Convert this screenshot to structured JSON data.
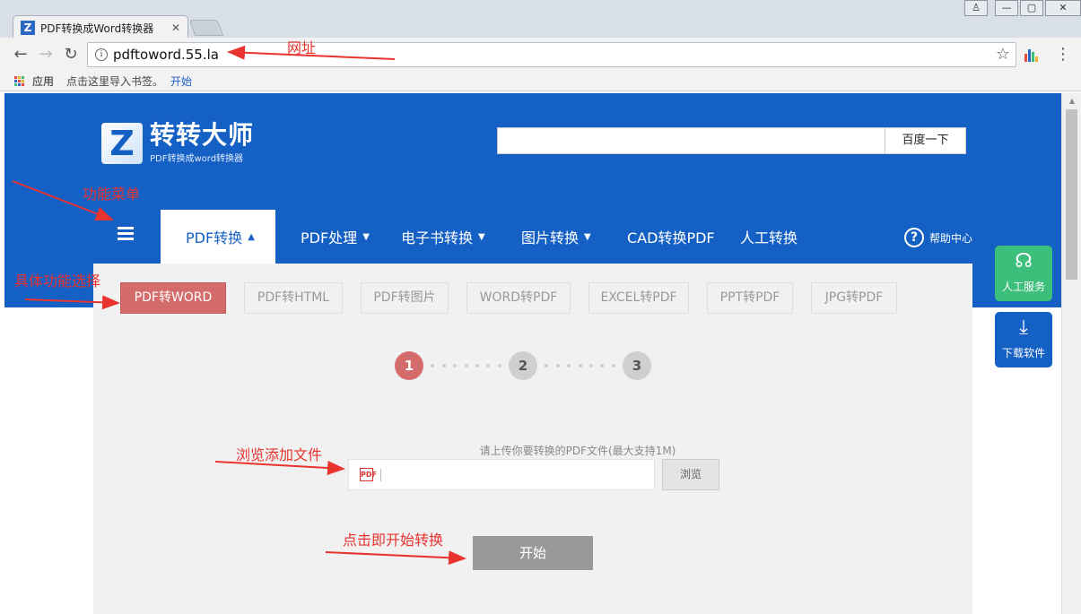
{
  "browser": {
    "tab_title": "PDF转换成Word转换器",
    "tab_close": "✕",
    "favicon_letter": "Z",
    "window_user": "♙",
    "window_minimize": "—",
    "window_maximize": "▢",
    "window_close": "✕",
    "back": "←",
    "forward": "→",
    "reload": "↻",
    "url": "pdftoword.55.la",
    "info": "i",
    "star": "☆",
    "menu": "⋮",
    "bookmarks": {
      "apps": "应用",
      "hint": "点击这里导入书签。",
      "start": "开始"
    }
  },
  "site": {
    "logo_letter": "Z",
    "logo_main": "转转大师",
    "logo_sub": "PDF转换成word转换器",
    "search_button": "百度一下",
    "search_value": "",
    "nav": [
      {
        "label": "PDF转换",
        "caret": "▲"
      },
      {
        "label": "PDF处理",
        "caret": "▼"
      },
      {
        "label": "电子书转换",
        "caret": "▼"
      },
      {
        "label": "图片转换",
        "caret": "▼"
      },
      {
        "label": "CAD转换PDF",
        "caret": ""
      },
      {
        "label": "人工转换",
        "caret": ""
      }
    ],
    "help": {
      "icon": "?",
      "label": "帮助中心"
    },
    "subtabs": [
      "PDF转WORD",
      "PDF转HTML",
      "PDF转图片",
      "WORD转PDF",
      "EXCEL转PDF",
      "PPT转PDF",
      "JPG转PDF"
    ],
    "steps": [
      "1",
      "2",
      "3"
    ],
    "upload_hint": "请上传你要转换的PDF文件(最大支持1M)",
    "pdf_icon": "PDF",
    "browse_button": "浏览",
    "start_button": "开始",
    "float_service": {
      "icon": "☊",
      "label": "人工服务"
    },
    "float_download": {
      "icon": "⤓",
      "label": "下载软件"
    }
  },
  "annotations": {
    "url": "网址",
    "menu": "功能菜单",
    "function": "具体功能选择",
    "browse": "浏览添加文件",
    "start": "点击即开始转换"
  },
  "colors": {
    "brand_blue": "#1560c4",
    "active_red": "#d56c6c",
    "service_green": "#3dbf7c",
    "annotation_red": "#e8332f"
  }
}
